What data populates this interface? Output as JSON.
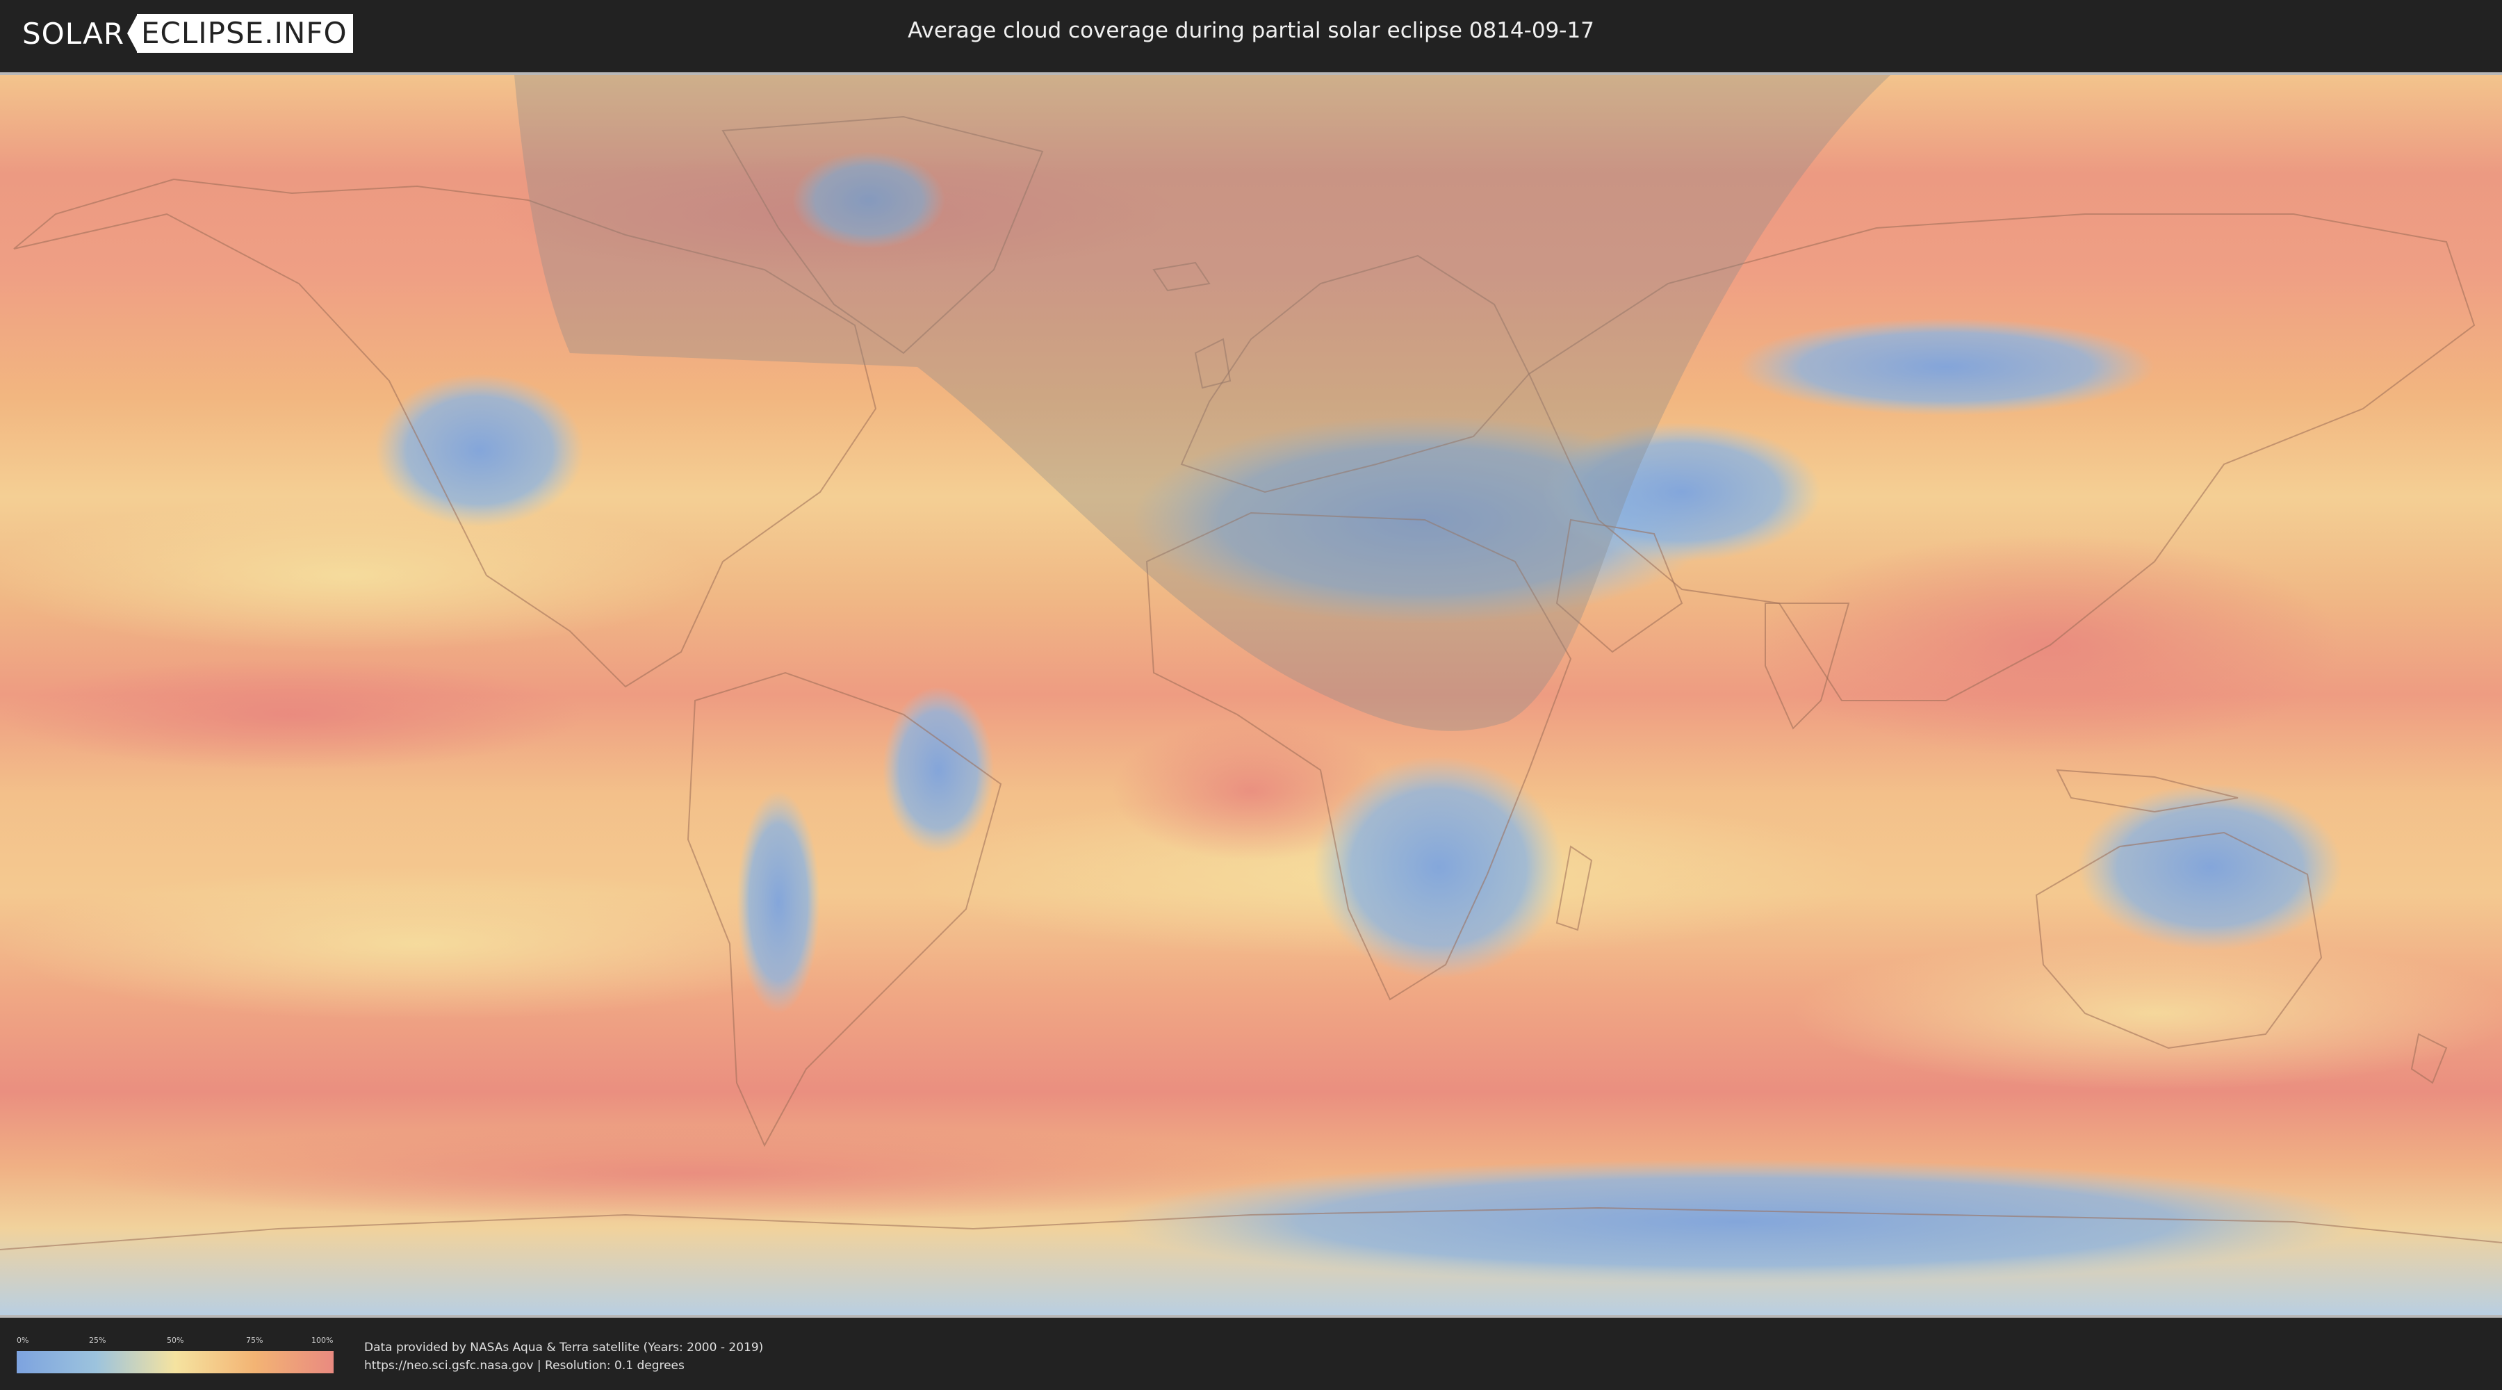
{
  "header": {
    "logo_left": "SOLAR",
    "logo_right": "ECLIPSE.INFO",
    "title": "Average cloud coverage during partial solar eclipse 0814-09-17"
  },
  "map": {
    "projection": "equirectangular",
    "layer": "average cloud coverage",
    "eclipse_visibility_shading": "partial eclipse zone shaded in gray",
    "colors": {
      "low": "#7da3df",
      "mid_low": "#9cc3dd",
      "mid": "#f5e3a0",
      "mid_high": "#f3b474",
      "high": "#e98a80",
      "eclipse_shade": "#8a8a8a"
    }
  },
  "legend": {
    "ticks": [
      "0%",
      "25%",
      "50%",
      "75%",
      "100%"
    ]
  },
  "footer": {
    "credit_line_1": "Data provided by NASAs Aqua & Terra satellite (Years: 2000 - 2019)",
    "credit_line_2": "https://neo.sci.gsfc.nasa.gov | Resolution: 0.1 degrees"
  }
}
